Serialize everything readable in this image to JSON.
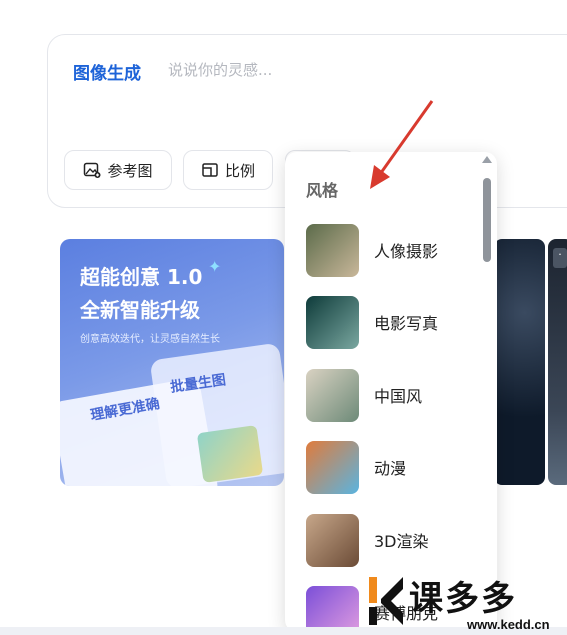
{
  "prompt": {
    "mode_title": "图像生成",
    "placeholder": "说说你的灵感..."
  },
  "toolbar": {
    "reference_label": "参考图",
    "ratio_label": "比例"
  },
  "banner": {
    "title_line1": "超能创意 1.0",
    "title_line2": "全新智能升级",
    "subtitle": "创意高效迭代，让灵感自然生长",
    "card_batch": "批量生图",
    "card_understand": "理解更准确"
  },
  "style_menu": {
    "header": "风格",
    "items": [
      {
        "label": "人像摄影",
        "icon": "portrait-photo-thumb",
        "colors": [
          "#5b6b4a",
          "#c9b79a"
        ]
      },
      {
        "label": "电影写真",
        "icon": "cinematic-photo-thumb",
        "colors": [
          "#0e3b3a",
          "#7aa7a0"
        ]
      },
      {
        "label": "中国风",
        "icon": "chinese-style-thumb",
        "colors": [
          "#d9d2c2",
          "#6d8a78"
        ]
      },
      {
        "label": "动漫",
        "icon": "anime-thumb",
        "colors": [
          "#e07b3c",
          "#5ab4e0"
        ]
      },
      {
        "label": "3D渲染",
        "icon": "3d-render-thumb",
        "colors": [
          "#c7a78a",
          "#6b4b36"
        ]
      },
      {
        "label": "赛博朋克",
        "icon": "cyberpunk-thumb",
        "colors": [
          "#7b4fd8",
          "#e49fe0"
        ]
      }
    ]
  },
  "watermark": {
    "brand": "课多多",
    "url": "www.kedd.cn"
  },
  "colors": {
    "accent": "#1d63d8",
    "arrow": "#d83a2e"
  }
}
